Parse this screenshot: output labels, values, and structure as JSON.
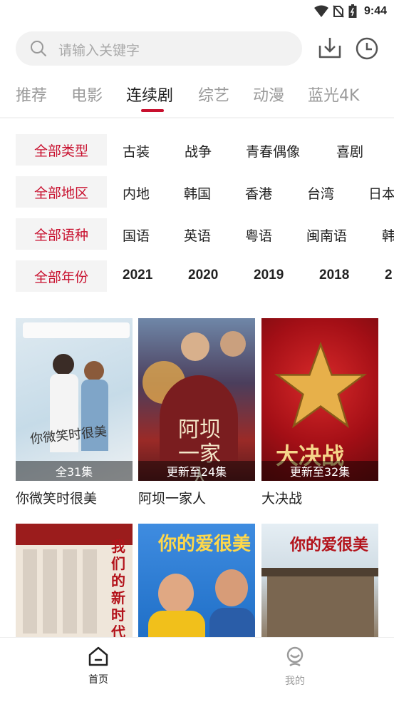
{
  "status": {
    "time": "9:44"
  },
  "search": {
    "placeholder": "请输入关键字"
  },
  "tabs": [
    {
      "label": "推荐"
    },
    {
      "label": "电影"
    },
    {
      "label": "连续剧"
    },
    {
      "label": "综艺"
    },
    {
      "label": "动漫"
    },
    {
      "label": "蓝光4K"
    }
  ],
  "active_tab": "连续剧",
  "filters": [
    {
      "label": "全部类型",
      "options": [
        "古装",
        "战争",
        "青春偶像",
        "喜剧"
      ]
    },
    {
      "label": "全部地区",
      "options": [
        "内地",
        "韩国",
        "香港",
        "台湾",
        "日本"
      ]
    },
    {
      "label": "全部语种",
      "options": [
        "国语",
        "英语",
        "粤语",
        "闽南语",
        "韩"
      ]
    },
    {
      "label": "全部年份",
      "options": [
        "2021",
        "2020",
        "2019",
        "2018",
        "2"
      ]
    }
  ],
  "cards": [
    {
      "title": "你微笑时很美",
      "badge": "全31集",
      "poster_text": "你微笑时很美",
      "poster_colors": [
        "#cfe0ea",
        "#e9eef2"
      ]
    },
    {
      "title": "阿坝一家人",
      "badge": "更新至24集",
      "poster_text": "阿坝一家人",
      "poster_colors": [
        "#4a3b6b",
        "#b8322c"
      ]
    },
    {
      "title": "大决战",
      "badge": "更新至32集",
      "poster_text": "大决战",
      "poster_colors": [
        "#b3121a",
        "#7a0b10"
      ]
    },
    {
      "poster_text": "我们的新时代",
      "poster_colors": [
        "#9b1c1c",
        "#e9e2d8"
      ]
    },
    {
      "poster_text": "你的爱很美",
      "poster_colors": [
        "#2f7dd8",
        "#6fb0ef"
      ]
    },
    {
      "poster_text": "你的爱很美",
      "poster_colors": [
        "#d9e7ef",
        "#8c7a64"
      ]
    }
  ],
  "bottom_nav": [
    {
      "label": "首页"
    },
    {
      "label": "我的"
    }
  ],
  "colors": {
    "accent": "#c8102e",
    "inactive": "#9a9a9a"
  }
}
